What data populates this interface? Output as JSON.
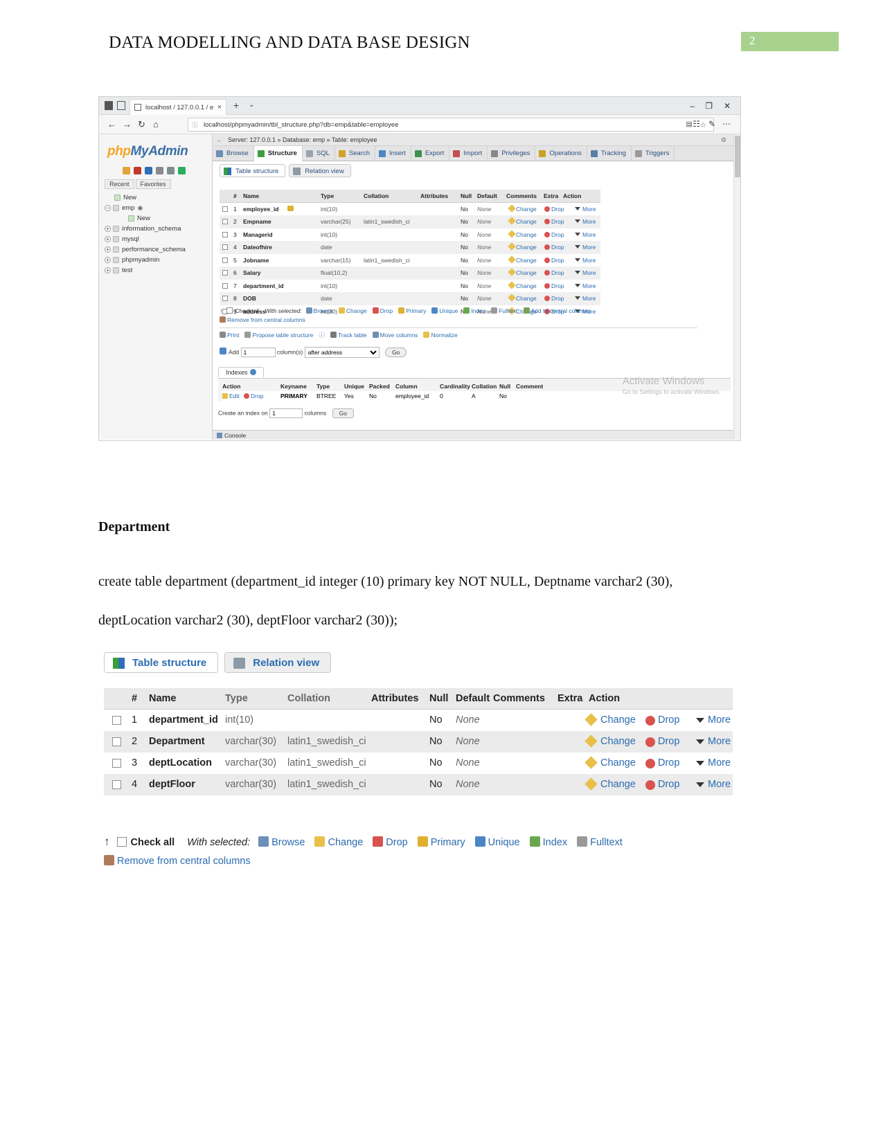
{
  "document": {
    "header_title": "DATA MODELLING AND DATA BASE DESIGN",
    "page_number": "2",
    "section_heading": "Department",
    "sql_statement": "create table department (department_id integer (10) primary key NOT NULL, Deptname varchar2 (30), deptLocation varchar2 (30), deptFloor varchar2 (30));"
  },
  "browser": {
    "tab_title": "localhost / 127.0.0.1 / e",
    "tab_close": "×",
    "new_tab": "+",
    "tab_chevron": "⌄",
    "minimize": "–",
    "maximize": "❐",
    "close": "✕",
    "back": "←",
    "forward": "→",
    "reload": "↻",
    "home": "⌂",
    "url": "localhost/phpmyadmin/tbl_structure.php?db=emp&table=employee",
    "info_icon": "ⓘ",
    "reader_icon": "▤",
    "star_icon": "☆",
    "collections_icon": "☷",
    "favorites_icon": "✎",
    "settings_icon": "⋯"
  },
  "pma_nav": {
    "logo_php": "php",
    "logo_myadmin": "MyAdmin",
    "icons": [
      "home-icon",
      "sql-icon",
      "globe-icon",
      "docs-icon",
      "settings-icon",
      "refresh-icon"
    ],
    "tabs": [
      "Recent",
      "Favorites"
    ],
    "tree": [
      {
        "label": "New",
        "indent": 1,
        "expander": "",
        "type": "new"
      },
      {
        "label": "emp",
        "indent": 0,
        "expander": "−",
        "type": "db",
        "eye": "◉"
      },
      {
        "label": "New",
        "indent": 2,
        "expander": "",
        "type": "newtable"
      },
      {
        "label": "information_schema",
        "indent": 0,
        "expander": "+",
        "type": "db"
      },
      {
        "label": "mysql",
        "indent": 0,
        "expander": "+",
        "type": "db"
      },
      {
        "label": "performance_schema",
        "indent": 0,
        "expander": "+",
        "type": "db"
      },
      {
        "label": "phpmyadmin",
        "indent": 0,
        "expander": "+",
        "type": "db"
      },
      {
        "label": "test",
        "indent": 0,
        "expander": "+",
        "type": "db"
      }
    ]
  },
  "pma_main": {
    "breadcrumb": "Server: 127.0.0.1 » Database: emp » Table: employee",
    "back_arrow": "←",
    "gear": "⚙",
    "minus": "−",
    "tabs": [
      {
        "label": "Browse",
        "icon": "browse-icon",
        "active": false
      },
      {
        "label": "Structure",
        "icon": "structure-icon",
        "active": true
      },
      {
        "label": "SQL",
        "icon": "sql-icon",
        "active": false
      },
      {
        "label": "Search",
        "icon": "search-icon",
        "active": false
      },
      {
        "label": "Insert",
        "icon": "insert-icon",
        "active": false
      },
      {
        "label": "Export",
        "icon": "export-icon",
        "active": false
      },
      {
        "label": "Import",
        "icon": "import-icon",
        "active": false
      },
      {
        "label": "Privileges",
        "icon": "privileges-icon",
        "active": false
      },
      {
        "label": "Operations",
        "icon": "operations-icon",
        "active": false
      },
      {
        "label": "Tracking",
        "icon": "tracking-icon",
        "active": false
      },
      {
        "label": "Triggers",
        "icon": "triggers-icon",
        "active": false
      }
    ],
    "subtabs": [
      {
        "label": "Table structure",
        "active": true
      },
      {
        "label": "Relation view",
        "active": false
      }
    ],
    "structure_headers": [
      "#",
      "Name",
      "Type",
      "Collation",
      "Attributes",
      "Null",
      "Default",
      "Comments",
      "Extra",
      "Action"
    ],
    "structure_rows": [
      {
        "num": "1",
        "name": "employee_id",
        "key": true,
        "type": "int(10)",
        "collation": "",
        "attributes": "",
        "null": "No",
        "default": "None",
        "comments": "",
        "extra": ""
      },
      {
        "num": "2",
        "name": "Empname",
        "key": false,
        "type": "varchar(25)",
        "collation": "latin1_swedish_ci",
        "attributes": "",
        "null": "No",
        "default": "None",
        "comments": "",
        "extra": ""
      },
      {
        "num": "3",
        "name": "Managerid",
        "key": false,
        "type": "int(10)",
        "collation": "",
        "attributes": "",
        "null": "No",
        "default": "None",
        "comments": "",
        "extra": ""
      },
      {
        "num": "4",
        "name": "Dateofhire",
        "key": false,
        "type": "date",
        "collation": "",
        "attributes": "",
        "null": "No",
        "default": "None",
        "comments": "",
        "extra": ""
      },
      {
        "num": "5",
        "name": "Jobname",
        "key": false,
        "type": "varchar(15)",
        "collation": "latin1_swedish_ci",
        "attributes": "",
        "null": "No",
        "default": "None",
        "comments": "",
        "extra": ""
      },
      {
        "num": "6",
        "name": "Salary",
        "key": false,
        "type": "float(10,2)",
        "collation": "",
        "attributes": "",
        "null": "No",
        "default": "None",
        "comments": "",
        "extra": ""
      },
      {
        "num": "7",
        "name": "department_id",
        "key": false,
        "type": "int(10)",
        "collation": "",
        "attributes": "",
        "null": "No",
        "default": "None",
        "comments": "",
        "extra": ""
      },
      {
        "num": "8",
        "name": "DOB",
        "key": false,
        "type": "date",
        "collation": "",
        "attributes": "",
        "null": "No",
        "default": "None",
        "comments": "",
        "extra": ""
      },
      {
        "num": "9",
        "name": "address",
        "key": false,
        "type": "int(30)",
        "collation": "",
        "attributes": "",
        "null": "No",
        "default": "None",
        "comments": "",
        "extra": ""
      }
    ],
    "row_actions": {
      "change": "Change",
      "drop": "Drop",
      "more": "More"
    },
    "footer": {
      "check_all": "Check all",
      "with_selected": "With selected:",
      "actions": [
        "Browse",
        "Change",
        "Drop",
        "Primary",
        "Unique",
        "Index",
        "Fulltext",
        "Add to central columns"
      ],
      "remove_central": "Remove from central columns"
    },
    "tools": [
      "Print",
      "Propose table structure",
      "Track table",
      "Move columns",
      "Normalize"
    ],
    "add_row": {
      "add_label": "Add",
      "count": "1",
      "columns_label": "column(s)",
      "position": "after address",
      "go": "Go"
    },
    "indexes": {
      "title": "Indexes",
      "headers": [
        "Action",
        "Keyname",
        "Type",
        "Unique",
        "Packed",
        "Column",
        "Cardinality",
        "Collation",
        "Null",
        "Comment"
      ],
      "rows": [
        {
          "edit": "Edit",
          "drop": "Drop",
          "keyname": "PRIMARY",
          "type": "BTREE",
          "unique": "Yes",
          "packed": "No",
          "column": "employee_id",
          "cardinality": "0",
          "collation": "A",
          "null": "No",
          "comment": ""
        }
      ],
      "create_label": "Create an index on",
      "create_count": "1",
      "create_columns": "columns",
      "create_go": "Go"
    },
    "watermark_line1": "Activate Windows",
    "watermark_line2": "Go to Settings to activate Windows.",
    "console": "Console"
  },
  "dept_structure": {
    "subtabs": [
      {
        "label": "Table structure",
        "active": true
      },
      {
        "label": "Relation view",
        "active": false
      }
    ],
    "headers": [
      "#",
      "Name",
      "Type",
      "Collation",
      "Attributes",
      "Null",
      "Default",
      "Comments",
      "Extra",
      "Action"
    ],
    "rows": [
      {
        "num": "1",
        "name": "department_id",
        "type": "int(10)",
        "collation": "",
        "attributes": "",
        "null": "No",
        "default": "None",
        "comments": "",
        "extra": ""
      },
      {
        "num": "2",
        "name": "Department",
        "type": "varchar(30)",
        "collation": "latin1_swedish_ci",
        "attributes": "",
        "null": "No",
        "default": "None",
        "comments": "",
        "extra": ""
      },
      {
        "num": "3",
        "name": "deptLocation",
        "type": "varchar(30)",
        "collation": "latin1_swedish_ci",
        "attributes": "",
        "null": "No",
        "default": "None",
        "comments": "",
        "extra": ""
      },
      {
        "num": "4",
        "name": "deptFloor",
        "type": "varchar(30)",
        "collation": "latin1_swedish_ci",
        "attributes": "",
        "null": "No",
        "default": "None",
        "comments": "",
        "extra": ""
      }
    ],
    "row_actions": {
      "change": "Change",
      "drop": "Drop",
      "more": ""
    },
    "footer": {
      "check_all": "Check all",
      "with_selected": "With selected:",
      "actions": [
        "Browse",
        "Change",
        "Drop",
        "Primary",
        "Unique",
        "Index",
        "Fulltext"
      ],
      "remove_central": "Remove from central columns"
    }
  },
  "colors": {
    "page_number_bg": "#a9d18e",
    "link": "#2b6cb0",
    "header_bg": "#e9e9e9",
    "alt_row": "#ebebeb"
  }
}
